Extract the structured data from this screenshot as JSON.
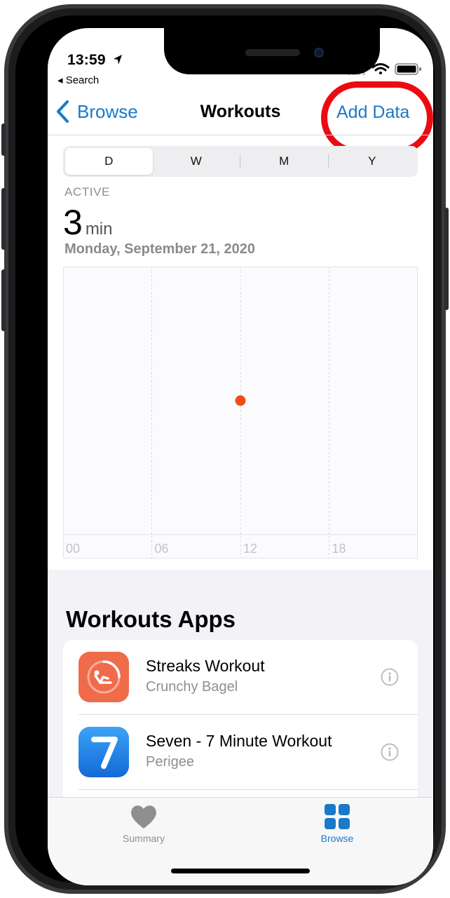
{
  "status_bar": {
    "time": "13:59",
    "back_app": "◂ Search"
  },
  "nav": {
    "back_label": "Browse",
    "title": "Workouts",
    "action_label": "Add Data"
  },
  "segments": [
    {
      "label": "D",
      "selected": true
    },
    {
      "label": "W",
      "selected": false
    },
    {
      "label": "M",
      "selected": false
    },
    {
      "label": "Y",
      "selected": false
    }
  ],
  "summary": {
    "category": "ACTIVE",
    "value": "3",
    "unit": "min",
    "date": "Monday, September 21, 2020"
  },
  "chart_data": {
    "type": "scatter",
    "x_ticks": [
      "00",
      "06",
      "12",
      "18"
    ],
    "x_range_hours": [
      0,
      24
    ],
    "points": [
      {
        "x_hour": 12,
        "y": 3
      }
    ],
    "point_color": "#f04e15",
    "grid": true
  },
  "apps_section": {
    "title": "Workouts Apps",
    "items": [
      {
        "name": "Streaks Workout",
        "developer": "Crunchy Bagel",
        "icon": "streaks-workout-icon"
      },
      {
        "name": "Seven - 7 Minute Workout",
        "developer": "Perigee",
        "icon": "seven-workout-icon"
      }
    ]
  },
  "tabbar": {
    "tabs": [
      {
        "label": "Summary",
        "icon": "heart-icon",
        "selected": false
      },
      {
        "label": "Browse",
        "icon": "grid-icon",
        "selected": true
      }
    ]
  },
  "colors": {
    "accent": "#1a79c9",
    "highlight_circle": "#ec0b12",
    "inactive_tab": "#8e8e93"
  }
}
